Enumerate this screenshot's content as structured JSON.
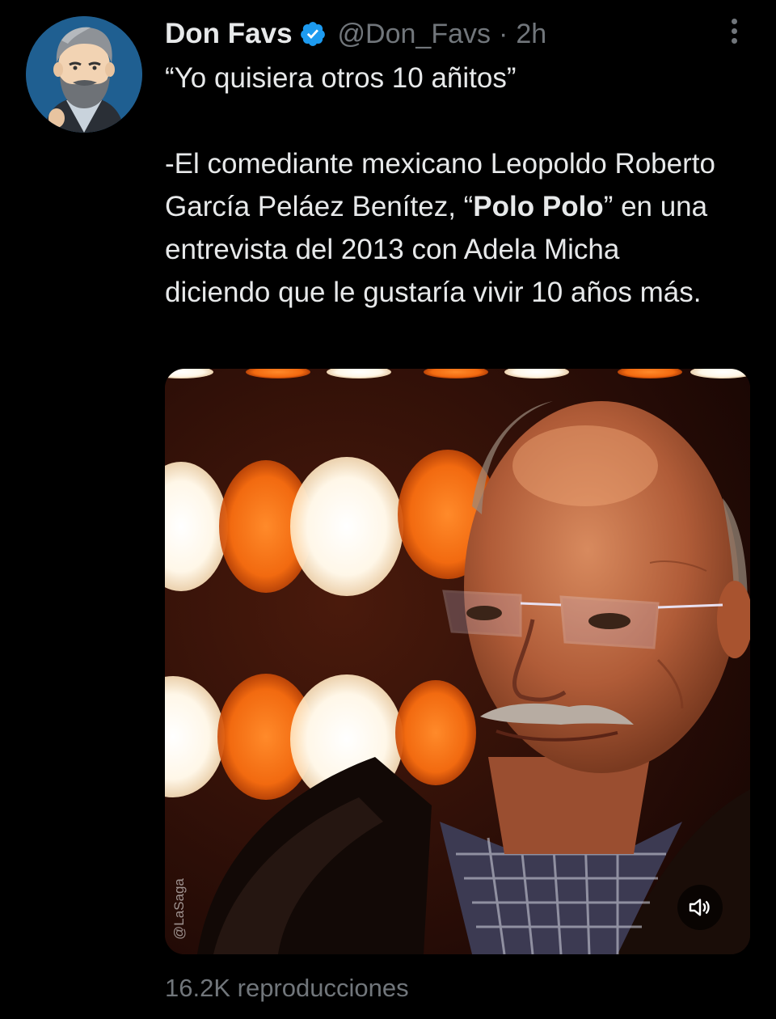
{
  "tweet": {
    "author": {
      "display_name": "Don Favs",
      "verified": true,
      "verified_icon": "verified-badge-icon",
      "handle": "@Don_Favs",
      "separator": "·",
      "time": "2h",
      "avatar_icon": "cartoon-bearded-man-avatar"
    },
    "more_icon": "more-vertical-icon",
    "text": {
      "line1": "“Yo quisiera otros 10 añitos”",
      "para2_part1": "-El comediante mexicano Leopoldo Roberto García Peláez Benítez, “",
      "para2_bold": "Polo Polo",
      "para2_part2": "” en una entrevista del 2013 con Adela Micha diciendo que le gustaría vivir 10 años más."
    },
    "media": {
      "type": "video",
      "watermark": "@LaSaga",
      "mute_icon": "volume-muted-icon"
    },
    "views": "16.2K reproducciones"
  },
  "colors": {
    "background": "#000000",
    "text_primary": "#e7e9ea",
    "text_secondary": "#71767b",
    "verified_blue": "#1d9bf0"
  }
}
